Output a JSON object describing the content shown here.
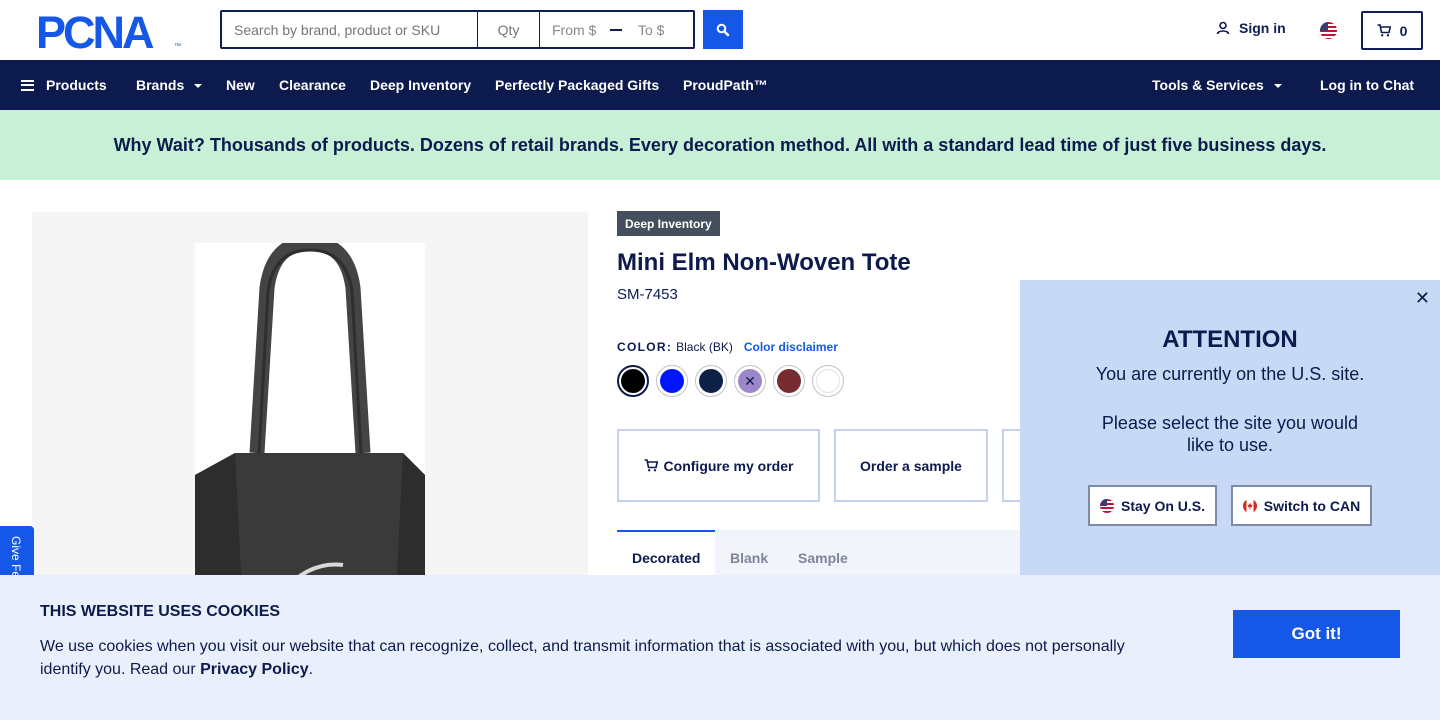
{
  "header": {
    "logo_text": "PCNA",
    "logo_mark": "™",
    "search_placeholder": "Search by brand, product or SKU",
    "qty_placeholder": "Qty",
    "price_from": "From $",
    "price_to": "To $",
    "signin_label": "Sign in",
    "cart_count": "0"
  },
  "nav": {
    "items": [
      {
        "label": "Products"
      },
      {
        "label": "Brands"
      },
      {
        "label": "New"
      },
      {
        "label": "Clearance"
      },
      {
        "label": "Deep Inventory"
      },
      {
        "label": "Perfectly Packaged Gifts"
      },
      {
        "label": "ProudPath™"
      }
    ],
    "tools_label": "Tools & Services",
    "chat_label": "Log in to Chat"
  },
  "banner": {
    "text": "Why Wait? Thousands of products. Dozens of retail brands. Every decoration method. All with a standard lead time of just five business days."
  },
  "product": {
    "badge": "Deep Inventory",
    "title": "Mini Elm Non-Woven Tote",
    "sku": "SM-7453",
    "color_label": "COLOR:",
    "color_value": "Black (BK)",
    "color_disclaimer": "Color disclaimer",
    "swatches": [
      {
        "name": "black",
        "color": "#000000"
      },
      {
        "name": "royal-blue",
        "color": "#0015ff"
      },
      {
        "name": "navy",
        "color": "#0d2046"
      },
      {
        "name": "purple",
        "color": "#9b87c9"
      },
      {
        "name": "burgundy",
        "color": "#762c30"
      },
      {
        "name": "white",
        "color": "#ffffff"
      }
    ],
    "configure_label": "Configure my order",
    "sample_label": "Order a sample",
    "tabs": [
      {
        "label": "Decorated"
      },
      {
        "label": "Blank"
      },
      {
        "label": "Sample"
      }
    ]
  },
  "feedback_label": "Give Fe",
  "attention": {
    "title": "ATTENTION",
    "line1": "You are currently on the U.S. site.",
    "line2": "Please select the site you would",
    "line3": "like to use.",
    "stay_label": "Stay On U.S.",
    "switch_label": "Switch to CAN"
  },
  "cookie": {
    "title": "THIS WEBSITE USES COOKIES",
    "text": "We use cookies when you visit our website that can recognize, collect, and transmit information that is associated with you, but which does not personally identify you. Read our",
    "link": "Privacy Policy",
    "end": ".",
    "button": "Got it!"
  },
  "colors": {
    "navy": "#0c1a4d",
    "accent_blue": "#1558e8",
    "banner_green": "#c7f0d7",
    "modal_blue": "#c7d9f4"
  }
}
